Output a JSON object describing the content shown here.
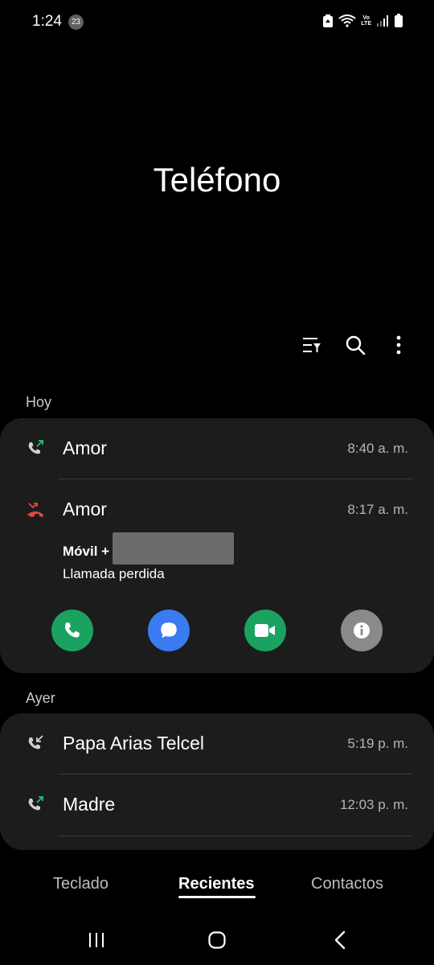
{
  "status_bar": {
    "time": "1:24",
    "notification_count": "23",
    "volte_line1": "Vo",
    "volte_line2": "LTE"
  },
  "app": {
    "title": "Teléfono"
  },
  "toolbar": {
    "filter_icon": "filter-list-icon",
    "search_icon": "search-icon",
    "more_icon": "more-vert-icon"
  },
  "sections": [
    {
      "label": "Hoy",
      "calls": [
        {
          "name": "Amor",
          "time": "8:40 a. m.",
          "type": "outgoing",
          "icon": "outgoing-call-icon"
        },
        {
          "name": "Amor",
          "time": "8:17 a. m.",
          "type": "missed",
          "icon": "missed-call-icon",
          "expanded": {
            "number_type": "Móvil +",
            "status": "Llamada perdida",
            "actions": [
              {
                "name": "call",
                "icon": "phone-icon",
                "color": "#1aa260"
              },
              {
                "name": "message",
                "icon": "message-icon",
                "color": "#3a7bf2"
              },
              {
                "name": "video",
                "icon": "video-icon",
                "color": "#1aa260"
              },
              {
                "name": "info",
                "icon": "info-icon",
                "color": "#8a8a8a"
              }
            ]
          }
        }
      ]
    },
    {
      "label": "Ayer",
      "calls": [
        {
          "name": "Papa Arias Telcel",
          "time": "5:19 p. m.",
          "type": "incoming",
          "icon": "incoming-call-icon"
        },
        {
          "name": "Madre",
          "time": "12:03 p. m.",
          "type": "outgoing",
          "icon": "outgoing-call-icon"
        }
      ]
    }
  ],
  "bottom_nav": {
    "tabs": [
      {
        "label": "Teclado",
        "active": false
      },
      {
        "label": "Recientes",
        "active": true
      },
      {
        "label": "Contactos",
        "active": false
      }
    ]
  },
  "colors": {
    "background": "#000000",
    "card": "#1c1c1c",
    "outgoing_arrow": "#2fbf6e",
    "missed": "#e5483c",
    "call_green": "#1aa260",
    "message_blue": "#3a7bf2",
    "info_gray": "#8a8a8a"
  }
}
